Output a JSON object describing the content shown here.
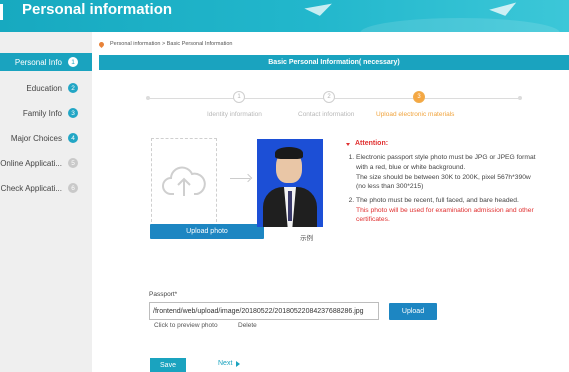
{
  "header": {
    "title": "Personal information"
  },
  "sidebar": {
    "items": [
      {
        "label": "Personal Info",
        "num": "1",
        "state": "active"
      },
      {
        "label": "Education",
        "num": "2",
        "state": "normal"
      },
      {
        "label": "Family Info",
        "num": "3",
        "state": "normal"
      },
      {
        "label": "Major Choices",
        "num": "4",
        "state": "normal"
      },
      {
        "label": "Online Applicati...",
        "num": "5",
        "state": "disabled"
      },
      {
        "label": "Check Applicati...",
        "num": "6",
        "state": "disabled"
      }
    ]
  },
  "breadcrumb": {
    "text": "Personal information > Basic Personal Information"
  },
  "panel": {
    "title": "Basic Personal Information( necessary)"
  },
  "steps": [
    {
      "num": "1",
      "label": "Identity information",
      "state": "done"
    },
    {
      "num": "2",
      "label": "Contact information",
      "state": "done"
    },
    {
      "num": "3",
      "label": "Upload electronic materials",
      "state": "current"
    }
  ],
  "upload": {
    "button_label": "Upload photo"
  },
  "sample": {
    "caption": "示例"
  },
  "attention": {
    "heading": "Attention:",
    "item1_line1": "Electronic passport style photo must be JPG or JPEG format with a red, blue or white background.",
    "item1_line2": "The size should be between 30K to 200K, pixel 567h*390w (no less than 300*215)",
    "item2_line1": "The photo must be recent, full faced, and bare headed.",
    "item2_red": "This photo will be used for examination admission and other certificates."
  },
  "passport": {
    "label": "Passport*",
    "value": "/frontend/web/upload/image/20180522/20180522084237688286.jpg",
    "upload_label": "Upload",
    "preview_label": "Click to preview photo",
    "delete_label": "Delete"
  },
  "actions": {
    "save_label": "Save",
    "next_label": "Next"
  },
  "colors": {
    "primary": "#1aa3bf",
    "button_blue": "#1d86c2",
    "step_current": "#f5a742",
    "alert_red": "#e03030"
  }
}
